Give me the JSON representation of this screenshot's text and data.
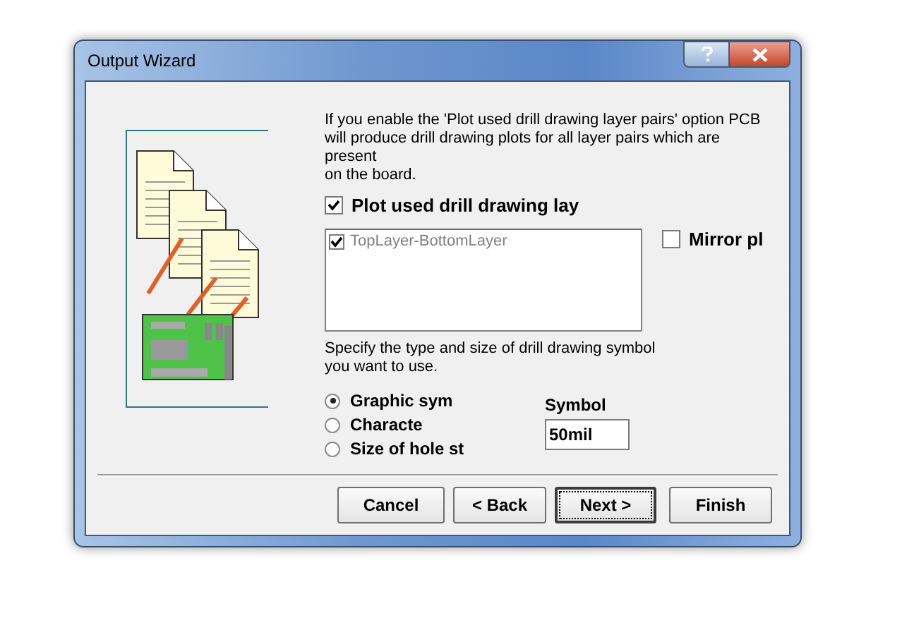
{
  "window": {
    "title": "Output Wizard"
  },
  "description": "If you enable the 'Plot used drill drawing layer pairs' option PCB\nwill produce drill drawing plots for all layer pairs which are\npresent\non the board.",
  "plot_option": {
    "label": "Plot used drill drawing lay",
    "checked": true
  },
  "layer_pairs": [
    {
      "label": "TopLayer-BottomLayer",
      "checked": true
    }
  ],
  "mirror_option": {
    "label": "Mirror pl",
    "checked": false
  },
  "symbol_hint": "Specify the type and size of drill drawing symbol\nyou want to use.",
  "symbol_types": [
    {
      "label": "Graphic sym",
      "selected": true
    },
    {
      "label": "Characte",
      "selected": false
    },
    {
      "label": "Size of hole st",
      "selected": false
    }
  ],
  "symbol_size": {
    "label": "Symbol",
    "value": "50mil"
  },
  "buttons": [
    {
      "label": "Cancel",
      "kind": "plain"
    },
    {
      "label": "< Back",
      "kind": "plain"
    },
    {
      "label": "Next >",
      "kind": "default"
    },
    {
      "label": "Finish",
      "kind": "plain"
    }
  ]
}
